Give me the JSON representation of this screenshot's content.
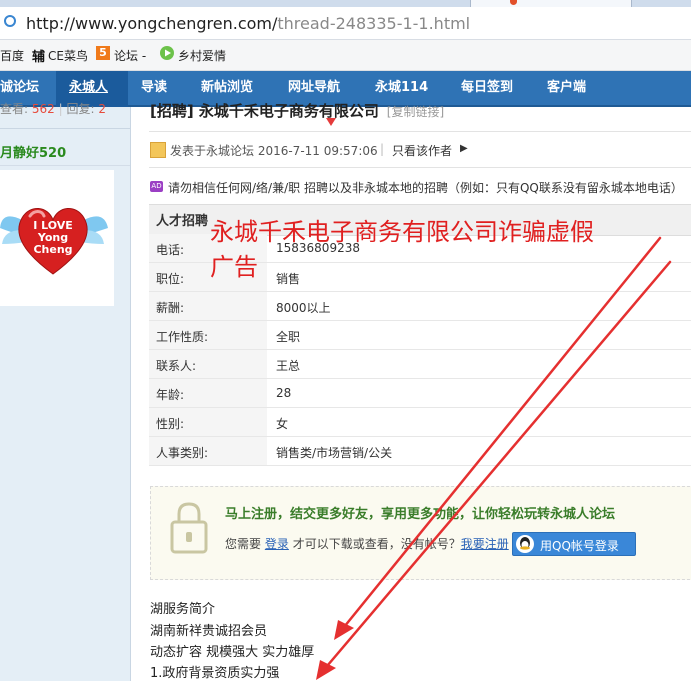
{
  "browser": {
    "url_host": "http://www.yongchengren.com/",
    "url_path": "thread-248335-1-1.html",
    "bookmarks": [
      {
        "label": "百度"
      },
      {
        "label": "CE菜鸟"
      },
      {
        "label": "论坛 -"
      },
      {
        "label": "乡村爱情"
      }
    ]
  },
  "nav": {
    "items": [
      "诚论坛",
      "永城人",
      "导读",
      "新帖浏览",
      "网址导航",
      "永城114",
      "每日签到",
      "客户端"
    ]
  },
  "sidebar": {
    "stats_views_label": "查看:",
    "stats_views": "562",
    "stats_replies_label": "回复:",
    "stats_replies": "2",
    "username": "月静好520",
    "avatar_line1": "I LOVE",
    "avatar_line2": "Yong",
    "avatar_line3": "Cheng"
  },
  "thread": {
    "title": "[招聘] 永城千禾电子商务有限公司",
    "copy_link": "[复制链接]",
    "posted": "发表于永城论坛 2016-7-11 09:57:06",
    "only_author": "只看该作者",
    "notice": "请勿相信任何网/络/兼/职 招聘以及非永城本地的招聘（例如：只有QQ联系没有留永城本地电话）",
    "section_header": "人才招聘",
    "fields": [
      {
        "label": "电话:",
        "value": "15836809238"
      },
      {
        "label": "职位:",
        "value": "销售"
      },
      {
        "label": "薪酬:",
        "value": "8000以上"
      },
      {
        "label": "工作性质:",
        "value": "全职"
      },
      {
        "label": "联系人:",
        "value": "王总"
      },
      {
        "label": "年龄:",
        "value": "28"
      },
      {
        "label": "性别:",
        "value": "女"
      },
      {
        "label": "人事类别:",
        "value": "销售类/市场营销/公关"
      }
    ]
  },
  "annotation": {
    "line1": "永城千禾电子商务有限公司诈骗虚假",
    "line2": "广告",
    "color": "#e02020"
  },
  "login": {
    "headline": "马上注册，结交更多好友，享用更多功能，让你轻松玩转永城人论坛",
    "prefix": "您需要",
    "login_link": "登录",
    "middle": "才可以下载或查看，没有帐号？",
    "register_link": "我要注册",
    "qq_button": "用QQ帐号登录"
  },
  "body_text": [
    "湖服务简介",
    "湖南新祥贵诚招会员",
    "动态扩容 规模强大 实力雄厚",
    "1.政府背景资质实力强"
  ]
}
